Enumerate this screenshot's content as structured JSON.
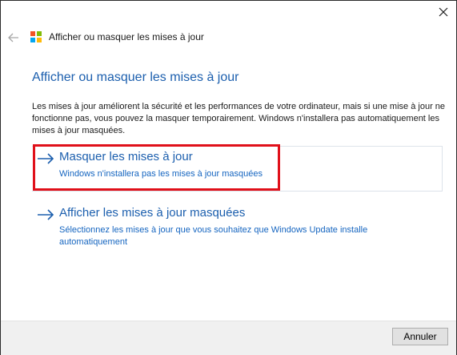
{
  "window": {
    "title": "Afficher ou masquer les mises à jour"
  },
  "main": {
    "heading": "Afficher ou masquer les mises à jour",
    "description": "Les mises à jour améliorent la sécurité et les performances de votre ordinateur, mais si une mise à jour ne fonctionne pas, vous pouvez la masquer temporairement. Windows n'installera pas automatiquement les mises à jour masquées.",
    "options": [
      {
        "title": "Masquer les mises à jour",
        "subtitle": "Windows n'installera pas les mises à jour masquées"
      },
      {
        "title": "Afficher les mises à jour masquées",
        "subtitle": "Sélectionnez les mises à jour que vous souhaitez que Windows Update installe automatiquement"
      }
    ]
  },
  "footer": {
    "cancel_label": "Annuler"
  },
  "icons": {
    "close": "close-icon",
    "back": "back-arrow-icon",
    "logo": "windows-logo-icon",
    "option_arrow": "right-arrow-icon"
  },
  "colors": {
    "accent": "#1c5fae",
    "link_subtitle": "#1565c0",
    "highlight": "#e0101a",
    "logo_red": "#f35325",
    "logo_green": "#81bc06",
    "logo_blue": "#05a6f0",
    "logo_yellow": "#ffba08"
  }
}
